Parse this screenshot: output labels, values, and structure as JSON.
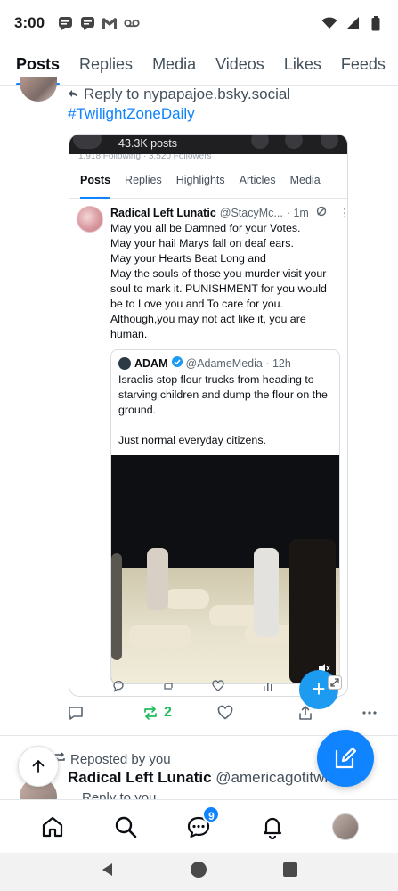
{
  "status_bar": {
    "time": "3:00"
  },
  "tabs": [
    "Posts",
    "Replies",
    "Media",
    "Videos",
    "Likes",
    "Feeds"
  ],
  "post1": {
    "reply_to": "Reply to nypapajoe.bsky.social",
    "hashtag": "#TwilightZoneDaily",
    "embed": {
      "posts_count": "43.3K posts",
      "profile_counts_partial": "1,918 Following · 3,520 Followers",
      "tabs": [
        "Posts",
        "Replies",
        "Highlights",
        "Articles",
        "Media"
      ],
      "inner_post": {
        "name": "Radical Left Lunatic",
        "handle": "@StacyMc...",
        "time": "· 1m",
        "text": "May you all be Damned for your Votes.\nMay your hail Marys fall on deaf ears.\nMay your Hearts Beat Long and\nMay the souls of those you murder visit your soul to mark it. PUNISHMENT for you would be to Love you and To care for you. Although,you may not act like it, you are human."
      },
      "quote": {
        "name": "ADAM",
        "handle": "@AdameMedia · 12h",
        "text": "Israelis stop flour trucks from heading to starving children and dump the flour on the ground.\n\nJust normal everyday citizens."
      }
    },
    "actions": {
      "reposts": "2"
    }
  },
  "post2": {
    "repost_label": "Reposted by you",
    "name": "Radical Left Lunatic",
    "handle": "@americagotitwrongo",
    "sub": "Reply to you"
  },
  "bottom_nav": {
    "chat_badge": "9"
  },
  "colors": {
    "accent": "#1083fe",
    "repost_green": "#20bc5c"
  }
}
